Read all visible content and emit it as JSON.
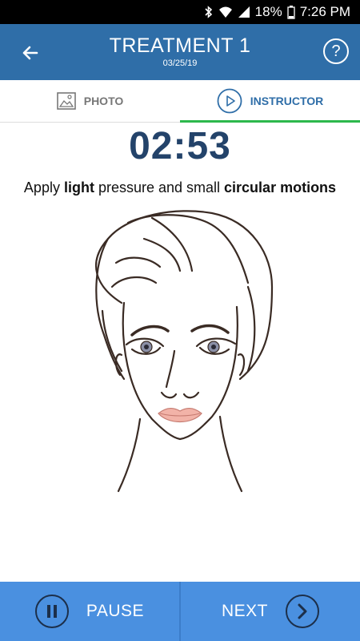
{
  "status_bar": {
    "battery": "18%",
    "time": "7:26 PM"
  },
  "header": {
    "title": "TREATMENT 1",
    "date": "03/25/19",
    "help_label": "?"
  },
  "tabs": [
    {
      "label": "PHOTO"
    },
    {
      "label": "INSTRUCTOR"
    }
  ],
  "active_tab": "INSTRUCTOR",
  "timer": "02:53",
  "instruction": {
    "prefix": "Apply ",
    "strong1": "light",
    "middle": " pressure and small ",
    "strong2": "circular motions"
  },
  "bottom": {
    "pause_label": "PAUSE",
    "next_label": "NEXT"
  },
  "colors": {
    "app_bar": "#2f6ea8",
    "timer": "#23436a",
    "bottom_bar": "#4a90e0",
    "tab_indicator": "#2db84c"
  }
}
